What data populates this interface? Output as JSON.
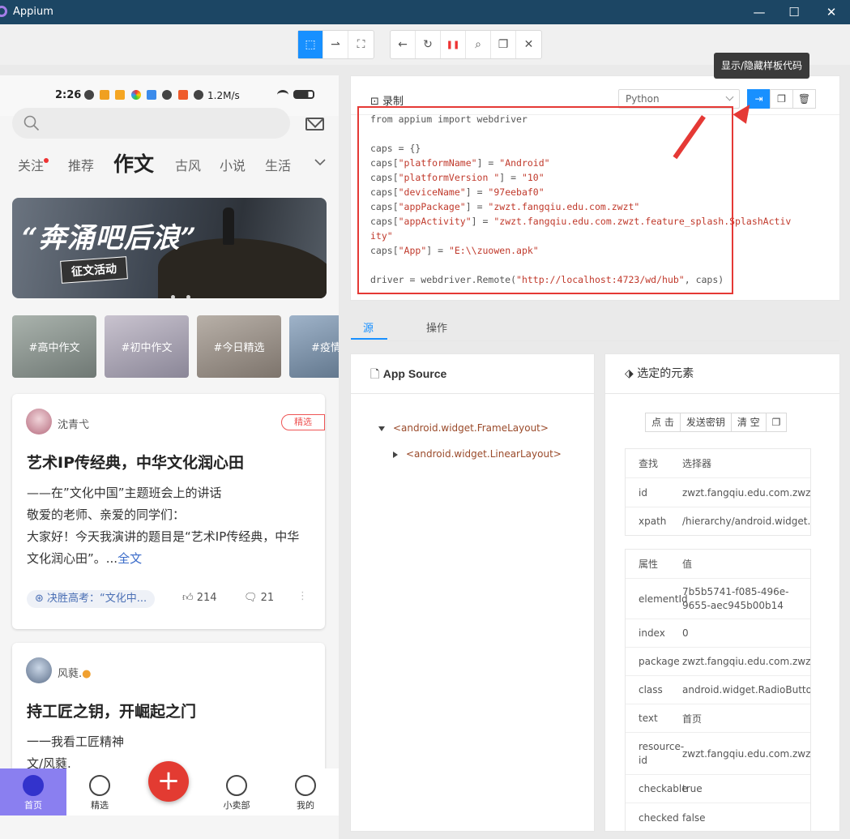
{
  "window": {
    "title": "Appium",
    "minimize": "—",
    "maximize": "☐",
    "close": "✕"
  },
  "toolbar": {
    "select_icon": "⬚",
    "swipe_icon": "⇀",
    "tap_icon": "⛶",
    "back_icon": "←",
    "refresh_icon": "↻",
    "pause_icon": "❚❚",
    "search_icon": "⌕",
    "copy_icon": "❐",
    "quit_icon": "✕"
  },
  "tooltip": "显示/隐藏样板代码",
  "phone": {
    "status": {
      "time": "2:26",
      "speed": "1.2M/s"
    },
    "tabs": [
      "关注",
      "推荐",
      "作文",
      "古风",
      "小说",
      "生活"
    ],
    "banner": {
      "title": "“奔涌吧后浪”",
      "subtitle": "征文活动"
    },
    "chips": [
      "#高中作文",
      "#初中作文",
      "#今日精选",
      "#疫情作"
    ],
    "cards": [
      {
        "author": "沈青弋",
        "badge": "精选",
        "title": "艺术IP传经典，中华文化润心田",
        "lines": [
          "——在”文化中国”主题班会上的讲话",
          "敬爱的老师、亲爱的同学们：",
          "大家好！今天我演讲的题目是“艺术IP传经典，中华",
          "文化润心田”。..."
        ],
        "more": "全文",
        "topic": "决胜高考：“文化中...",
        "likes": "214",
        "comments": "21"
      },
      {
        "author": "风蕤.",
        "title": "持工匠之钥，开崛起之门",
        "lines": [
          "一一我看工匠精神",
          "文/风蕤."
        ]
      }
    ],
    "nav": [
      "首页",
      "精选",
      "小卖部",
      "我的"
    ],
    "fab": "+"
  },
  "recorder": {
    "title": "录制",
    "language": "Python",
    "code": {
      "l1": "from appium import webdriver",
      "l2": "caps = {}",
      "k3": "caps[",
      "s3a": "\"platformName\"",
      "m3": "] = ",
      "s3b": "\"Android\"",
      "k4": "caps[",
      "s4a": "\"platformVersion \"",
      "m4": "] = ",
      "s4b": "\"10\"",
      "k5": "caps[",
      "s5a": "\"deviceName\"",
      "m5": "] = ",
      "s5b": "\"97eebaf0\"",
      "k6": "caps[",
      "s6a": "\"appPackage\"",
      "m6": "] = ",
      "s6b": "\"zwzt.fangqiu.edu.com.zwzt\"",
      "k7": "caps[",
      "s7a": "\"appActivity\"",
      "m7": "] = ",
      "s7b": "\"zwzt.fangqiu.edu.com.zwzt.feature_splash.SplashActiv",
      "s7c": "ity\"",
      "k8": "caps[",
      "s8a": "\"App\"",
      "m8": "] = ",
      "s8b": "\"E:\\\\zuowen.apk\"",
      "k9": "driver = webdriver.Remote(",
      "s9": "\"http://localhost:4723/wd/hub\"",
      "m9": ", caps)"
    }
  },
  "tabs": {
    "source": "源",
    "actions": "操作"
  },
  "appsource": {
    "title": "App Source",
    "nodes": [
      "<android.widget.FrameLayout>",
      "<android.widget.LinearLayout>"
    ]
  },
  "selected": {
    "title": "选定的元素",
    "buttons": [
      "点 击",
      "发送密钥",
      "清 空",
      "❐"
    ],
    "find_header": {
      "k": "查找",
      "v": "选择器"
    },
    "find": [
      {
        "k": "id",
        "v": "zwzt.fangqiu.edu.com.zwzt:id/disco"
      },
      {
        "k": "xpath",
        "v": "/hierarchy/android.widget.FrameLay"
      }
    ],
    "attr_header": {
      "k": "属性",
      "v": "值"
    },
    "attrs": [
      {
        "k": "elementId",
        "v": "7b5b5741-f085-496e-9655-aec945b00b14"
      },
      {
        "k": "index",
        "v": "0"
      },
      {
        "k": "package",
        "v": "zwzt.fangqiu.edu.com.zwzt"
      },
      {
        "k": "class",
        "v": "android.widget.RadioButton"
      },
      {
        "k": "text",
        "v": "首页"
      },
      {
        "k": "resource-id",
        "v": "zwzt.fangqiu.edu.com.zwzt:id/d"
      },
      {
        "k": "checkable",
        "v": "true"
      },
      {
        "k": "checked",
        "v": "false"
      }
    ]
  }
}
